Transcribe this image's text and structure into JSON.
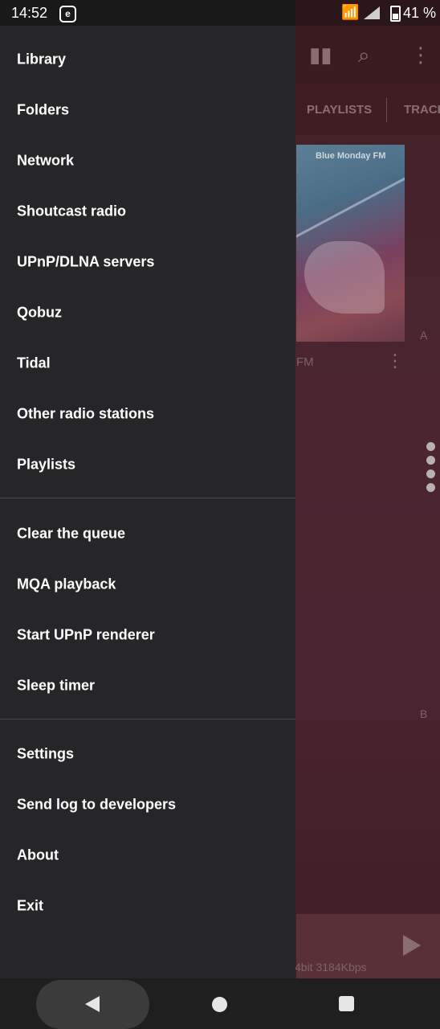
{
  "status_bar": {
    "time": "14:52",
    "notification_icon": "e-icon",
    "battery_text": "41 %"
  },
  "background_app": {
    "tabs": [
      "PLAYLISTS",
      "TRACK"
    ],
    "album": {
      "cover_text": "Blue Monday FM",
      "label_fragment": "FM"
    },
    "index_letters": [
      "A",
      "B"
    ],
    "mini_player": {
      "info": "4bit  3184Kbps"
    }
  },
  "drawer": {
    "sections": [
      {
        "items": [
          {
            "label": "Library"
          },
          {
            "label": "Folders"
          },
          {
            "label": "Network"
          },
          {
            "label": "Shoutcast radio"
          },
          {
            "label": "UPnP/DLNA servers"
          },
          {
            "label": "Qobuz"
          },
          {
            "label": "Tidal"
          },
          {
            "label": "Other radio stations"
          },
          {
            "label": "Playlists"
          }
        ]
      },
      {
        "items": [
          {
            "label": "Clear the queue"
          },
          {
            "label": "MQA playback"
          },
          {
            "label": "Start UPnP renderer"
          },
          {
            "label": "Sleep timer"
          }
        ]
      },
      {
        "items": [
          {
            "label": "Settings"
          },
          {
            "label": "Send log to developers"
          },
          {
            "label": "About"
          },
          {
            "label": "Exit"
          }
        ]
      }
    ]
  },
  "nav_bar": {
    "icons": [
      "back-icon",
      "home-icon",
      "recents-icon"
    ]
  }
}
